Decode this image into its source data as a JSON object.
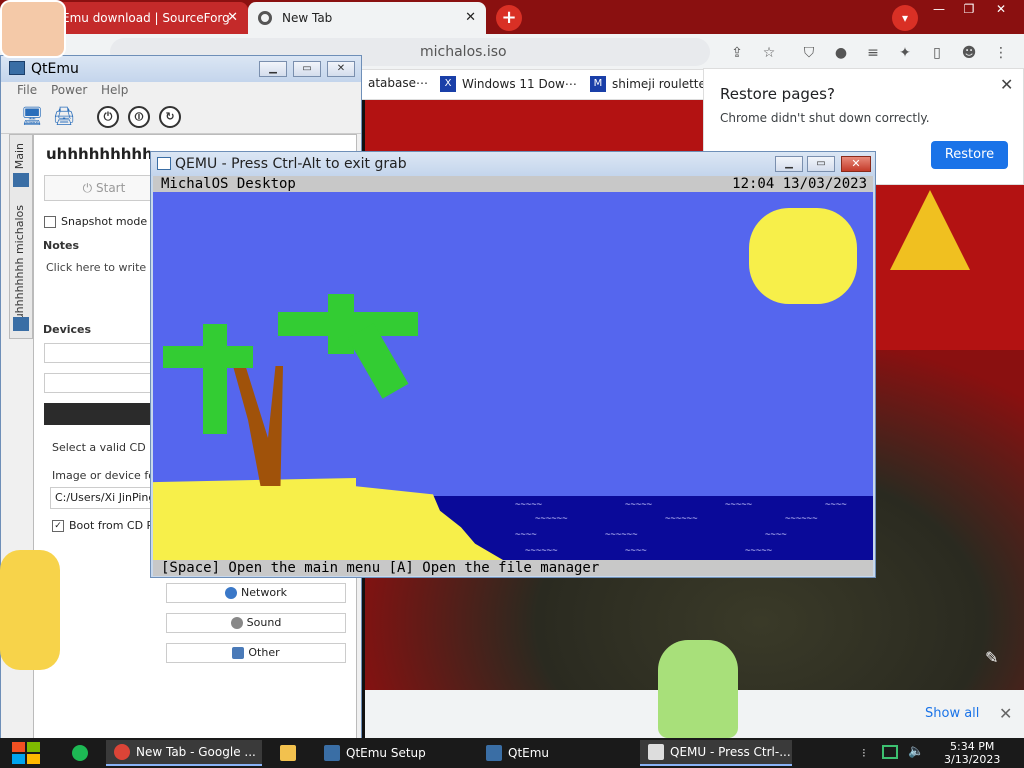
{
  "chrome": {
    "tabs": [
      {
        "title": "Emu download | SourceForg",
        "close": "✕"
      },
      {
        "title": "New Tab",
        "close": "✕"
      }
    ],
    "url": "michalos.iso",
    "bookmarks": [
      "atabase⋯",
      "Windows 11 Dow⋯",
      "shimeji roulette"
    ],
    "restore": {
      "title": "Restore pages?",
      "message": "Chrome didn't shut down correctly.",
      "button": "Restore"
    },
    "show_all": "Show all"
  },
  "qtemu": {
    "title": "QtEmu",
    "menu": [
      "File",
      "Power",
      "Help"
    ],
    "vtabs": [
      "Main",
      "uhhhhhhhh michalos"
    ],
    "vm_name": "uhhhhhhhhh",
    "start": "Start",
    "snapshot": "Snapshot mode",
    "notes_label": "Notes",
    "notes_placeholder": "Click here to write dov",
    "devices_label": "Devices",
    "cd_label": "Select a valid CD RO",
    "image_label": "Image or device for",
    "path": "C:/Users/Xi JinPing/",
    "boot": "Boot from CD RO",
    "network": "Network",
    "sound": "Sound",
    "other": "Other"
  },
  "qemu": {
    "title": "QEMU - Press Ctrl-Alt to exit grab",
    "os_name": "MichalOS Desktop",
    "clock": "12:04 13/03/2023",
    "status": "[Space] Open the main menu [A] Open the file manager"
  },
  "taskbar": {
    "items": [
      "New Tab - Google ...",
      "QtEmu Setup",
      "QtEmu",
      "QEMU - Press Ctrl-..."
    ],
    "time": "5:34 PM",
    "date": "3/13/2023"
  },
  "colors": {
    "desktop_blue": "#5566ee",
    "sea": "#0a0a99",
    "sun": "#f7ef4a",
    "chrome_accent": "#c42a2a"
  }
}
